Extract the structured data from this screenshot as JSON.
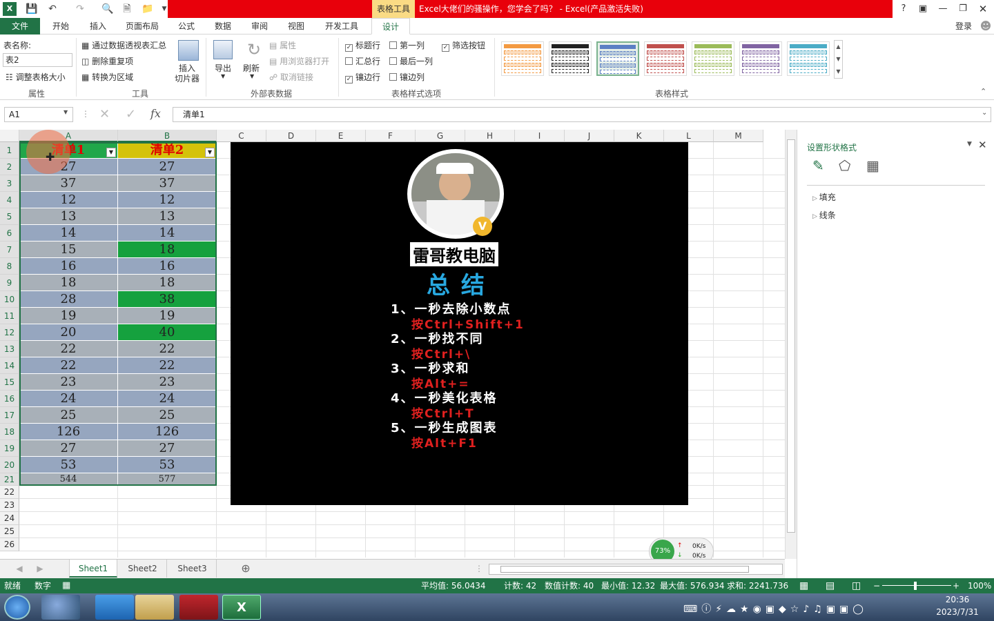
{
  "window": {
    "title": "Excel大佬们的骚操作，您学会了吗？ - Excel(产品激活失败)",
    "context_tab": "表格工具",
    "signin": "登录",
    "help": "?"
  },
  "tabs": [
    "文件",
    "开始",
    "插入",
    "页面布局",
    "公式",
    "数据",
    "审阅",
    "视图",
    "开发工具",
    "设计"
  ],
  "ribbon": {
    "tablename_label": "表名称:",
    "tablename_value": "表2",
    "resize": "调整表格大小",
    "g_props": "属性",
    "pivot": "通过数据透视表汇总",
    "remove_dup": "删除重复项",
    "to_range": "转换为区域",
    "slicer": "插入\n切片器",
    "g_tools": "工具",
    "export": "导出",
    "refresh": "刷新",
    "props": "属性",
    "browser_open": "用浏览器打开",
    "unlink": "取消链接",
    "g_external": "外部表数据",
    "opt_header": "标题行",
    "opt_first": "第一列",
    "opt_filter": "筛选按钮",
    "opt_total": "汇总行",
    "opt_last": "最后一列",
    "opt_banded_rows": "镶边行",
    "opt_banded_cols": "镶边列",
    "g_style_opts": "表格样式选项",
    "g_styles": "表格样式",
    "swatch_colors": [
      "#f39a42",
      "#222222",
      "#5b7fc4",
      "#c0504d",
      "#9bbb59",
      "#8064a2",
      "#4bacc6"
    ]
  },
  "formula": {
    "namebox": "A1",
    "fx": "fx",
    "content": "清单1"
  },
  "columns": [
    "A",
    "B",
    "C",
    "D",
    "E",
    "F",
    "G",
    "H",
    "I",
    "J",
    "K",
    "L",
    "M"
  ],
  "rows": [
    "1",
    "2",
    "3",
    "4",
    "5",
    "6",
    "7",
    "8",
    "9",
    "10",
    "11",
    "12",
    "13",
    "14",
    "15",
    "16",
    "17",
    "18",
    "19",
    "20",
    "21",
    "22",
    "23",
    "24",
    "25",
    "26"
  ],
  "table": {
    "headers": [
      "清单1",
      "清单2"
    ],
    "colA": [
      "27",
      "37",
      "12",
      "13",
      "14",
      "15",
      "16",
      "18",
      "28",
      "19",
      "20",
      "22",
      "22",
      "23",
      "24",
      "25",
      "126",
      "27",
      "53",
      "544"
    ],
    "colB": [
      "27",
      "37",
      "12",
      "13",
      "14",
      "18",
      "16",
      "18",
      "38",
      "19",
      "40",
      "22",
      "22",
      "23",
      "24",
      "25",
      "126",
      "27",
      "53",
      "577"
    ],
    "diff_rows": [
      5,
      8,
      10
    ],
    "colors": {
      "headerA": "#21a74a",
      "headerB": "#d4c20a",
      "band1": "#96a6bf",
      "band2": "#a8b0b8",
      "diff": "#15a13e"
    }
  },
  "image": {
    "name": "雷哥教电脑",
    "heading": "总 结",
    "items": [
      [
        "1、一秒去除小数点",
        "按Ctrl+Shift+1"
      ],
      [
        "2、一秒找不同",
        "按Ctrl+\\"
      ],
      [
        "3、一秒求和",
        "按Alt+="
      ],
      [
        "4、一秒美化表格",
        "按Ctrl+T"
      ],
      [
        "5、一秒生成图表",
        "按Alt+F1"
      ]
    ]
  },
  "pane": {
    "title": "设置形状格式",
    "fill": "填充",
    "line": "线条"
  },
  "sheets": [
    "Sheet1",
    "Sheet2",
    "Sheet3"
  ],
  "status": {
    "ready": "就绪",
    "num": "数字",
    "avg": "平均值: 56.0434",
    "count": "计数: 42",
    "numcount": "数值计数: 40",
    "min": "最小值: 12.32",
    "max": "最大值: 576.934",
    "sum": "求和: 2241.736",
    "zoom": "100%"
  },
  "netmon": {
    "pct": "73%",
    "up": "0K/s",
    "down": "0K/s"
  },
  "clock": {
    "time": "20:36",
    "date": "2023/7/31"
  }
}
